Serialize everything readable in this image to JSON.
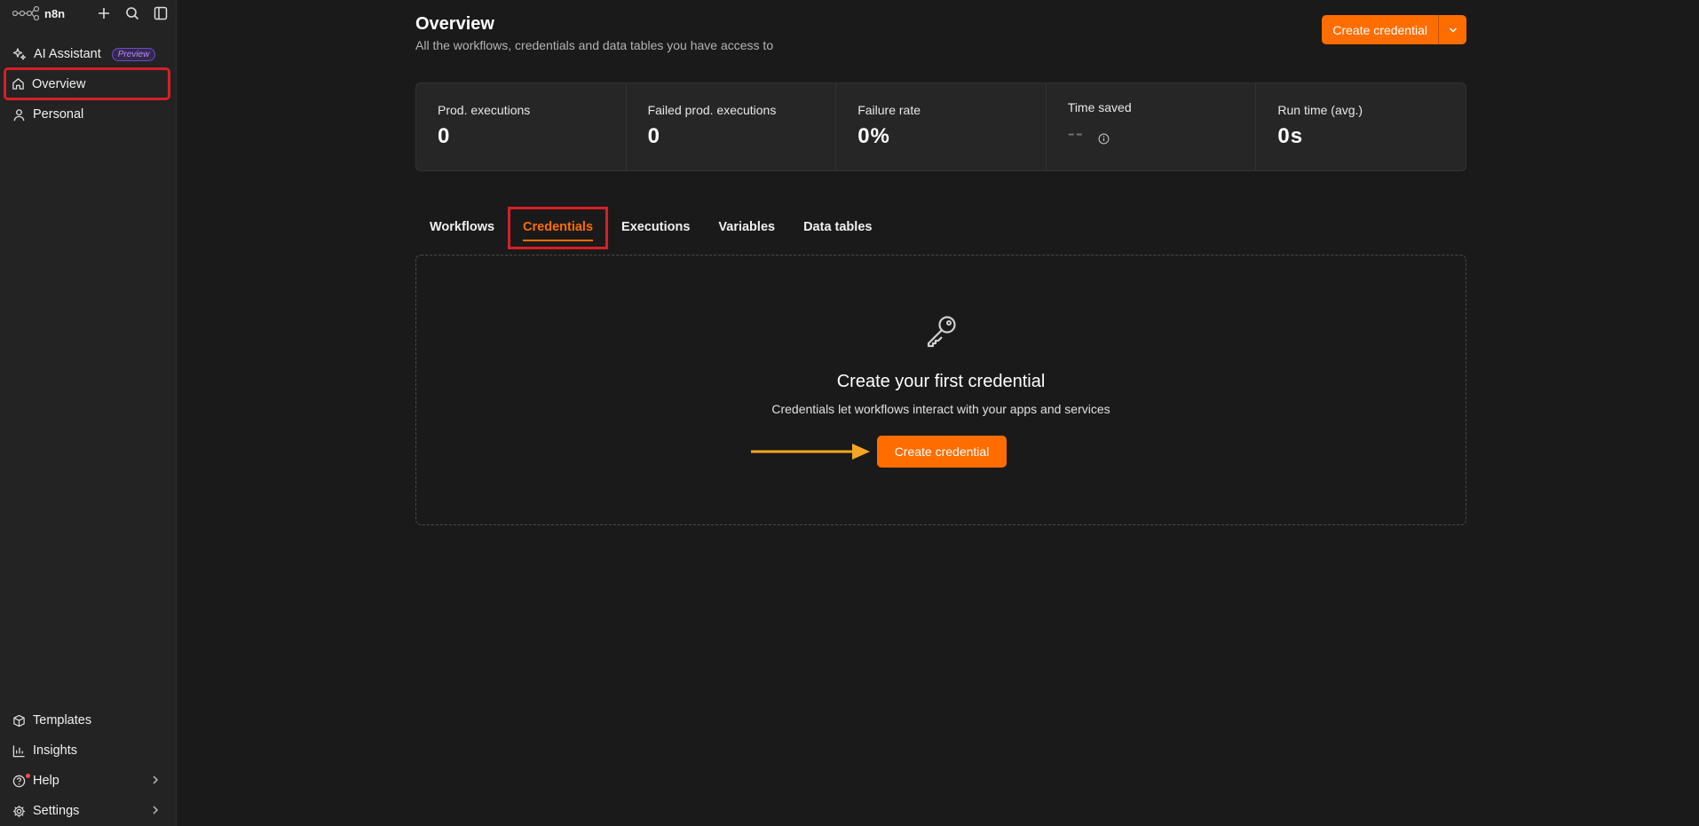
{
  "sidebar": {
    "logo_text": "n8n",
    "top_icons": [
      "plus-icon",
      "search-icon",
      "panel-toggle-icon"
    ],
    "items": [
      {
        "label": "AI Assistant",
        "icon": "sparkles-icon",
        "badge": "Preview"
      },
      {
        "label": "Overview",
        "icon": "home-icon",
        "active": true
      },
      {
        "label": "Personal",
        "icon": "user-icon"
      }
    ],
    "bottom_items": [
      {
        "label": "Templates",
        "icon": "box-icon"
      },
      {
        "label": "Insights",
        "icon": "chart-icon"
      },
      {
        "label": "Help",
        "icon": "help-circle-icon",
        "has_submenu": true
      },
      {
        "label": "Settings",
        "icon": "gear-icon",
        "has_submenu": true
      }
    ]
  },
  "header": {
    "title": "Overview",
    "subtitle": "All the workflows, credentials and data tables you have access to",
    "create_button": "Create credential"
  },
  "stats": [
    {
      "label": "Prod. executions",
      "value": "0"
    },
    {
      "label": "Failed prod. executions",
      "value": "0"
    },
    {
      "label": "Failure rate",
      "value": "0%"
    },
    {
      "label": "Time saved",
      "value": "--"
    },
    {
      "label": "Run time (avg.)",
      "value": "0s"
    }
  ],
  "tabs": [
    {
      "label": "Workflows"
    },
    {
      "label": "Credentials",
      "active": true
    },
    {
      "label": "Executions"
    },
    {
      "label": "Variables"
    },
    {
      "label": "Data tables"
    }
  ],
  "empty_state": {
    "icon": "key-icon",
    "title": "Create your first credential",
    "description": "Credentials let workflows interact with your apps and services",
    "button": "Create credential"
  },
  "colors": {
    "accent": "#ff6d00",
    "highlight": "#d71f26",
    "arrow": "#f5a623",
    "background": "#1a1a1a",
    "sidebar": "#232323"
  }
}
